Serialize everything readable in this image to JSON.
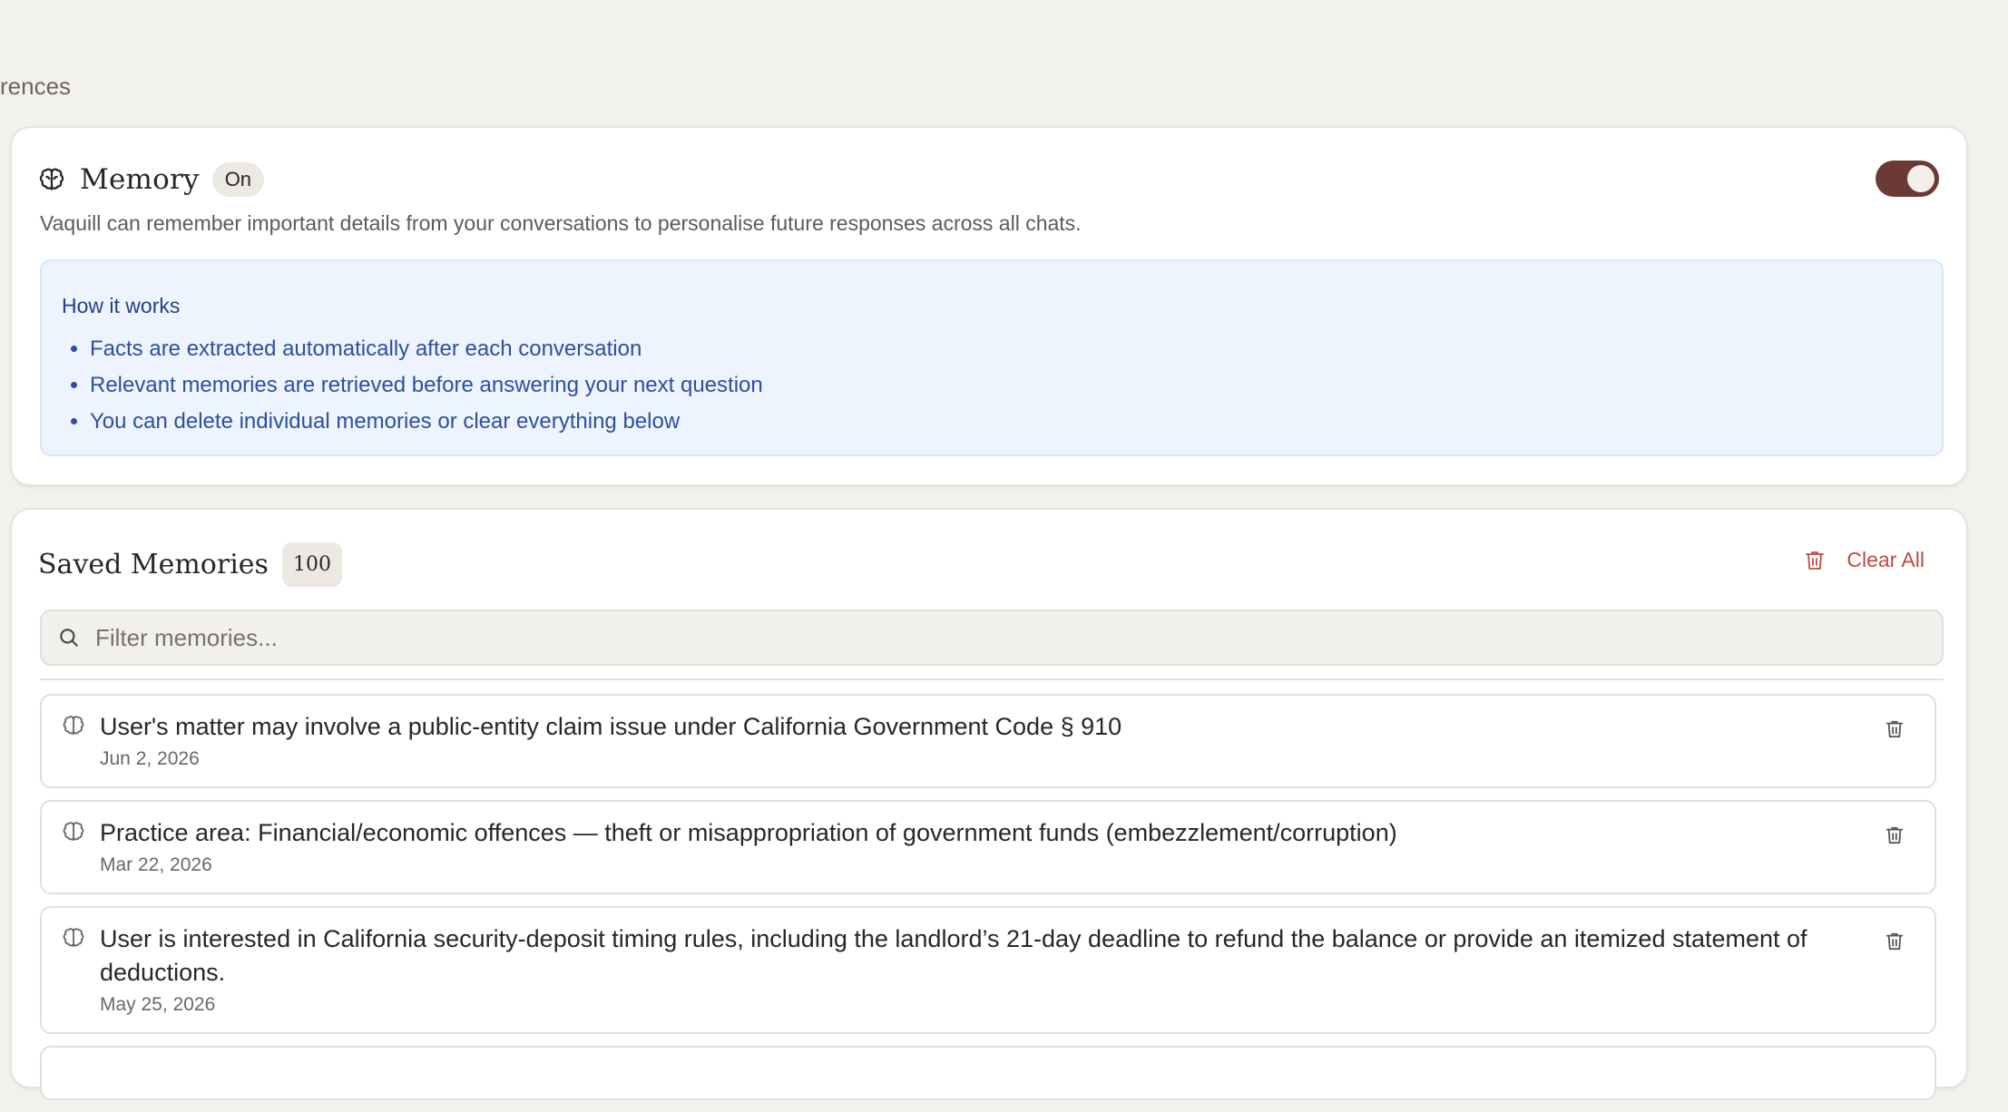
{
  "page": {
    "heading": "rences"
  },
  "memory": {
    "title": "Memory",
    "status_badge": "On",
    "enabled": true,
    "description": "Vaquill can remember important details from your conversations to personalise future responses across all chats.",
    "how_it_works": {
      "title": "How it works",
      "items": [
        "Facts are extracted automatically after each conversation",
        "Relevant memories are retrieved before answering your next question",
        "You can delete individual memories or clear everything below"
      ]
    }
  },
  "saved": {
    "title": "Saved Memories",
    "count": "100",
    "clear_all_label": "Clear All",
    "search_placeholder": "Filter memories...",
    "search_value": "",
    "items": [
      {
        "text": "User's matter may involve a public-entity claim issue under California Government Code § 910",
        "date": "Jun 2, 2026"
      },
      {
        "text": "Practice area: Financial/economic offences — theft or misappropriation of government funds (embezzlement/corruption)",
        "date": "Mar 22, 2026"
      },
      {
        "text": "User is interested in California security-deposit timing rules, including the landlord’s 21-day deadline to refund the balance or provide an itemized statement of deductions.",
        "date": "May 25, 2026"
      },
      {
        "text": "",
        "date": ""
      }
    ]
  },
  "icons": {
    "memory": "brain-icon",
    "item": "brain-icon",
    "delete": "trash-icon",
    "search": "search-icon"
  },
  "colors": {
    "background": "#f3f1ed",
    "toggle_on": "#6b3a35",
    "danger": "#c24a43",
    "info_bg": "#edf4fd",
    "info_text": "#2d4f9e"
  }
}
